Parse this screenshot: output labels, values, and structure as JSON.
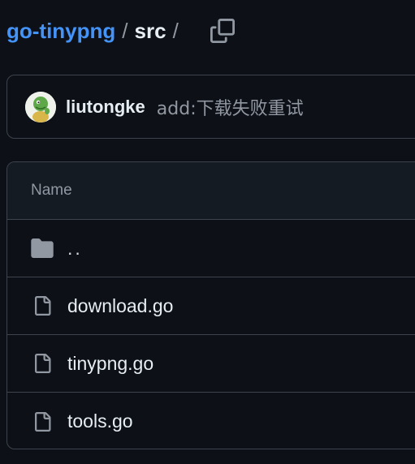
{
  "breadcrumb": {
    "repo": "go-tinypng",
    "separator": "/",
    "dir": "src"
  },
  "commit": {
    "author": "liutongke",
    "message": "add:下载失败重试"
  },
  "table": {
    "header": "Name",
    "rows": [
      {
        "name": "..",
        "icon": "folder-icon"
      },
      {
        "name": "download.go",
        "icon": "file-icon"
      },
      {
        "name": "tinypng.go",
        "icon": "file-icon"
      },
      {
        "name": "tools.go",
        "icon": "file-icon"
      }
    ]
  },
  "colors": {
    "background": "#0d1117",
    "link": "#4493f8",
    "border": "#3d444d",
    "muted": "#9198a1"
  }
}
